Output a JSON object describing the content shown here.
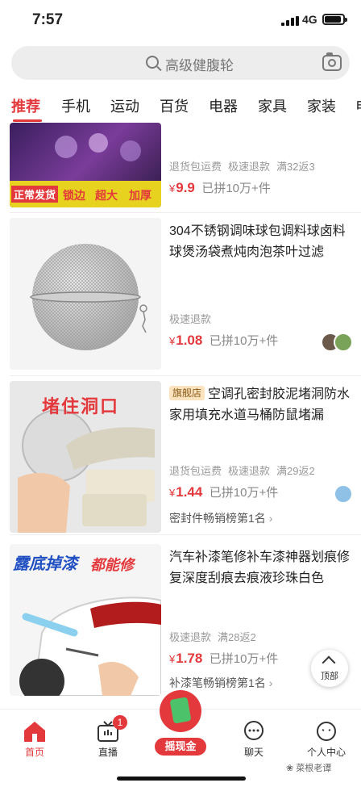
{
  "status_bar": {
    "time": "7:57",
    "network": "4G"
  },
  "search": {
    "placeholder": "高级健腹轮"
  },
  "tabs": [
    "推荐",
    "手机",
    "运动",
    "百货",
    "电器",
    "家具",
    "家装",
    "电"
  ],
  "active_tab": "推荐",
  "products": [
    {
      "title": "",
      "tags": [
        "退货包运费",
        "极速退款",
        "满32返3"
      ],
      "price_currency": "¥",
      "price": "9.9",
      "sold": "已拼10万+件",
      "banner_text": [
        "正常发货",
        "锁边",
        "超大",
        "加厚"
      ]
    },
    {
      "title": "304不锈钢调味球包调料球卤料球煲汤袋煮炖肉泡茶叶过滤",
      "tags": [
        "极速退款"
      ],
      "price_currency": "¥",
      "price": "1.08",
      "sold": "已拼10万+件"
    },
    {
      "flag": "旗舰店",
      "title": "空调孔密封胶泥堵洞防水家用填充水道马桶防鼠堵漏",
      "tags": [
        "退货包运费",
        "极速退款",
        "满29返2"
      ],
      "price_currency": "¥",
      "price": "1.44",
      "sold": "已拼10万+件",
      "rank": "密封件畅销榜第1名",
      "image_text": "堵住洞口"
    },
    {
      "title": "汽车补漆笔修补车漆神器划痕修复深度刮痕去痕液珍珠白色",
      "tags": [
        "极速退款",
        "满28返2"
      ],
      "price_currency": "¥",
      "price": "1.78",
      "sold": "已拼10万+件",
      "rank": "补漆笔畅销榜第1名",
      "image_text": [
        "露底掉漆",
        "都能修"
      ]
    }
  ],
  "back_to_top": "顶部",
  "nav": {
    "home": "首页",
    "live": "直播",
    "live_badge": "1",
    "center": "摇现金",
    "chat": "聊天",
    "profile": "个人中心"
  },
  "watermark": "菜根老谭",
  "colors": {
    "accent": "#e4393c",
    "tag_gray": "#999999"
  }
}
